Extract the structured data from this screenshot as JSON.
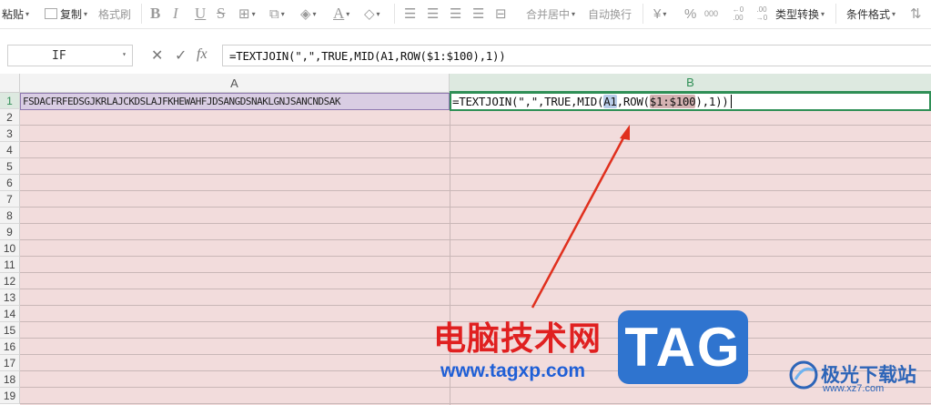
{
  "ribbon": {
    "paste_label": "粘贴",
    "copy_label": "复制",
    "format_painter_label": "格式刷",
    "bold": "B",
    "italic": "I",
    "underline": "U",
    "strike": "S",
    "merge_center_label": "合并居中",
    "auto_wrap_label": "自动换行",
    "currency": "¥",
    "percent": "%",
    "thousands": "000",
    "dec_inc": "←0 .00",
    "dec_dec": ".00 →0",
    "type_convert_label": "类型转换",
    "cond_format_label": "条件格式"
  },
  "formula_bar": {
    "name_box": "IF",
    "cancel_icon": "✕",
    "confirm_icon": "✓",
    "fx_label": "fx",
    "formula": "=TEXTJOIN(\",\",TRUE,MID(A1,ROW($1:$100),1))"
  },
  "columns": [
    {
      "label": "A",
      "selected": false
    },
    {
      "label": "B",
      "selected": true
    }
  ],
  "rows": [
    "1",
    "2",
    "3",
    "4",
    "5",
    "6",
    "7",
    "8",
    "9",
    "10",
    "11",
    "12",
    "13",
    "14",
    "15",
    "16",
    "17",
    "18",
    "19"
  ],
  "cells": {
    "A1": "FSDACFRFEDSGJKRLAJCKDSLAJFKHEWAHFJDSANGDSNAKLGNJSANCNDSAK",
    "B1_parts": {
      "p1": "=TEXTJOIN(\",\",TRUE,MID(",
      "ref_a1": "A1",
      "p2": ",ROW(",
      "ref_range": "$1:$100",
      "p3": "),1))"
    }
  },
  "watermark": {
    "cn_text": "电脑技术网",
    "tag_text": "TAG",
    "url": "www.tagxp.com",
    "jg_text": "极光下载站",
    "jg_url": "www.xz7.com"
  },
  "colors": {
    "accent_green": "#2f8f56",
    "cell_fill": "#f2dcdc",
    "a1_highlight": "#b9cdea",
    "range_highlight": "#d4b2b2",
    "arrow": "#e0301e",
    "watermark_red": "#e02020",
    "watermark_blue": "#2f74cf"
  }
}
